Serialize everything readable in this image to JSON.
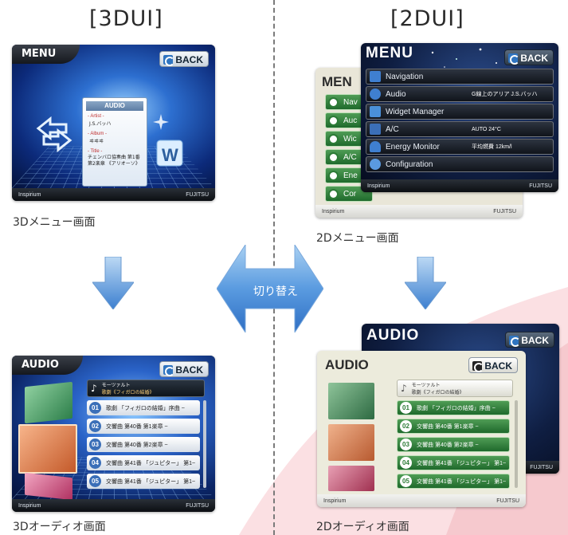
{
  "headings": {
    "left": "[3DUI]",
    "right": "[2DUI]"
  },
  "captions": {
    "menu3d": "3Dメニュー画面",
    "menu2d": "2Dメニュー画面",
    "audio3d": "3Dオーディオ画面",
    "audio2d": "2Dオーディオ画面"
  },
  "switch_label": "切り替え",
  "branding": {
    "left": "Inspirium",
    "right": "FUJITSU"
  },
  "colors": {
    "accent_blue": "#3b82d8",
    "menu_green": "#2f7d3a",
    "swoosh": "#fbe3e5"
  },
  "menu3d": {
    "title": "MENU",
    "back": "BACK",
    "popup": {
      "title": "AUDIO",
      "artist_label": "- Artist -",
      "artist": "J.S.バッハ",
      "album_label": "- Album -",
      "album": "ヰヰヰ",
      "title_label": "- Title -",
      "track": "チェンバロ協奏曲 第1番 第2楽章 《アリオーソ》"
    }
  },
  "menu2d": {
    "title": "MENU",
    "back": "BACK",
    "items": [
      {
        "label": "Navigation",
        "value": ""
      },
      {
        "label": "Audio",
        "value": "G線上のアリア J.S.バッハ"
      },
      {
        "label": "Widget Manager",
        "value": ""
      },
      {
        "label": "A/C",
        "value": "AUTO 24°C"
      },
      {
        "label": "Energy Monitor",
        "value": "平均燃費 12km/l"
      },
      {
        "label": "Configuration",
        "value": ""
      }
    ],
    "back_title": "MEN",
    "back_items": [
      "Nav",
      "Auc",
      "Wic",
      "A/C",
      "Ene",
      "Cor"
    ]
  },
  "audio3d": {
    "title": "AUDIO",
    "back": "BACK",
    "now_playing": {
      "artist": "モーツァルト",
      "album": "歌劇《フィガロの結婚》"
    },
    "tracks": [
      {
        "num": "01",
        "label": "歌劇 「フィガロの結婚」序曲 ~"
      },
      {
        "num": "02",
        "label": "交響曲 第40番 第1楽章 ~"
      },
      {
        "num": "03",
        "label": "交響曲 第40番 第2楽章 ~"
      },
      {
        "num": "04",
        "label": "交響曲 第41番 「ジュピター」 第1~"
      },
      {
        "num": "05",
        "label": "交響曲 第41番 「ジュピター」 第1~"
      }
    ]
  },
  "audio2d": {
    "title": "AUDIO",
    "back": "BACK",
    "now_playing": {
      "artist": "モーツァルト",
      "album": "歌劇《フィガロの結婚》"
    },
    "tracks": [
      {
        "num": "01",
        "label": "歌劇 「フィガロの結婚」序曲 ~"
      },
      {
        "num": "02",
        "label": "交響曲 第40番 第1楽章 ~"
      },
      {
        "num": "03",
        "label": "交響曲 第40番 第2楽章 ~"
      },
      {
        "num": "04",
        "label": "交響曲 第41番 「ジュピター」 第1~"
      },
      {
        "num": "05",
        "label": "交響曲 第41番 「ジュピター」 第1~"
      }
    ]
  }
}
